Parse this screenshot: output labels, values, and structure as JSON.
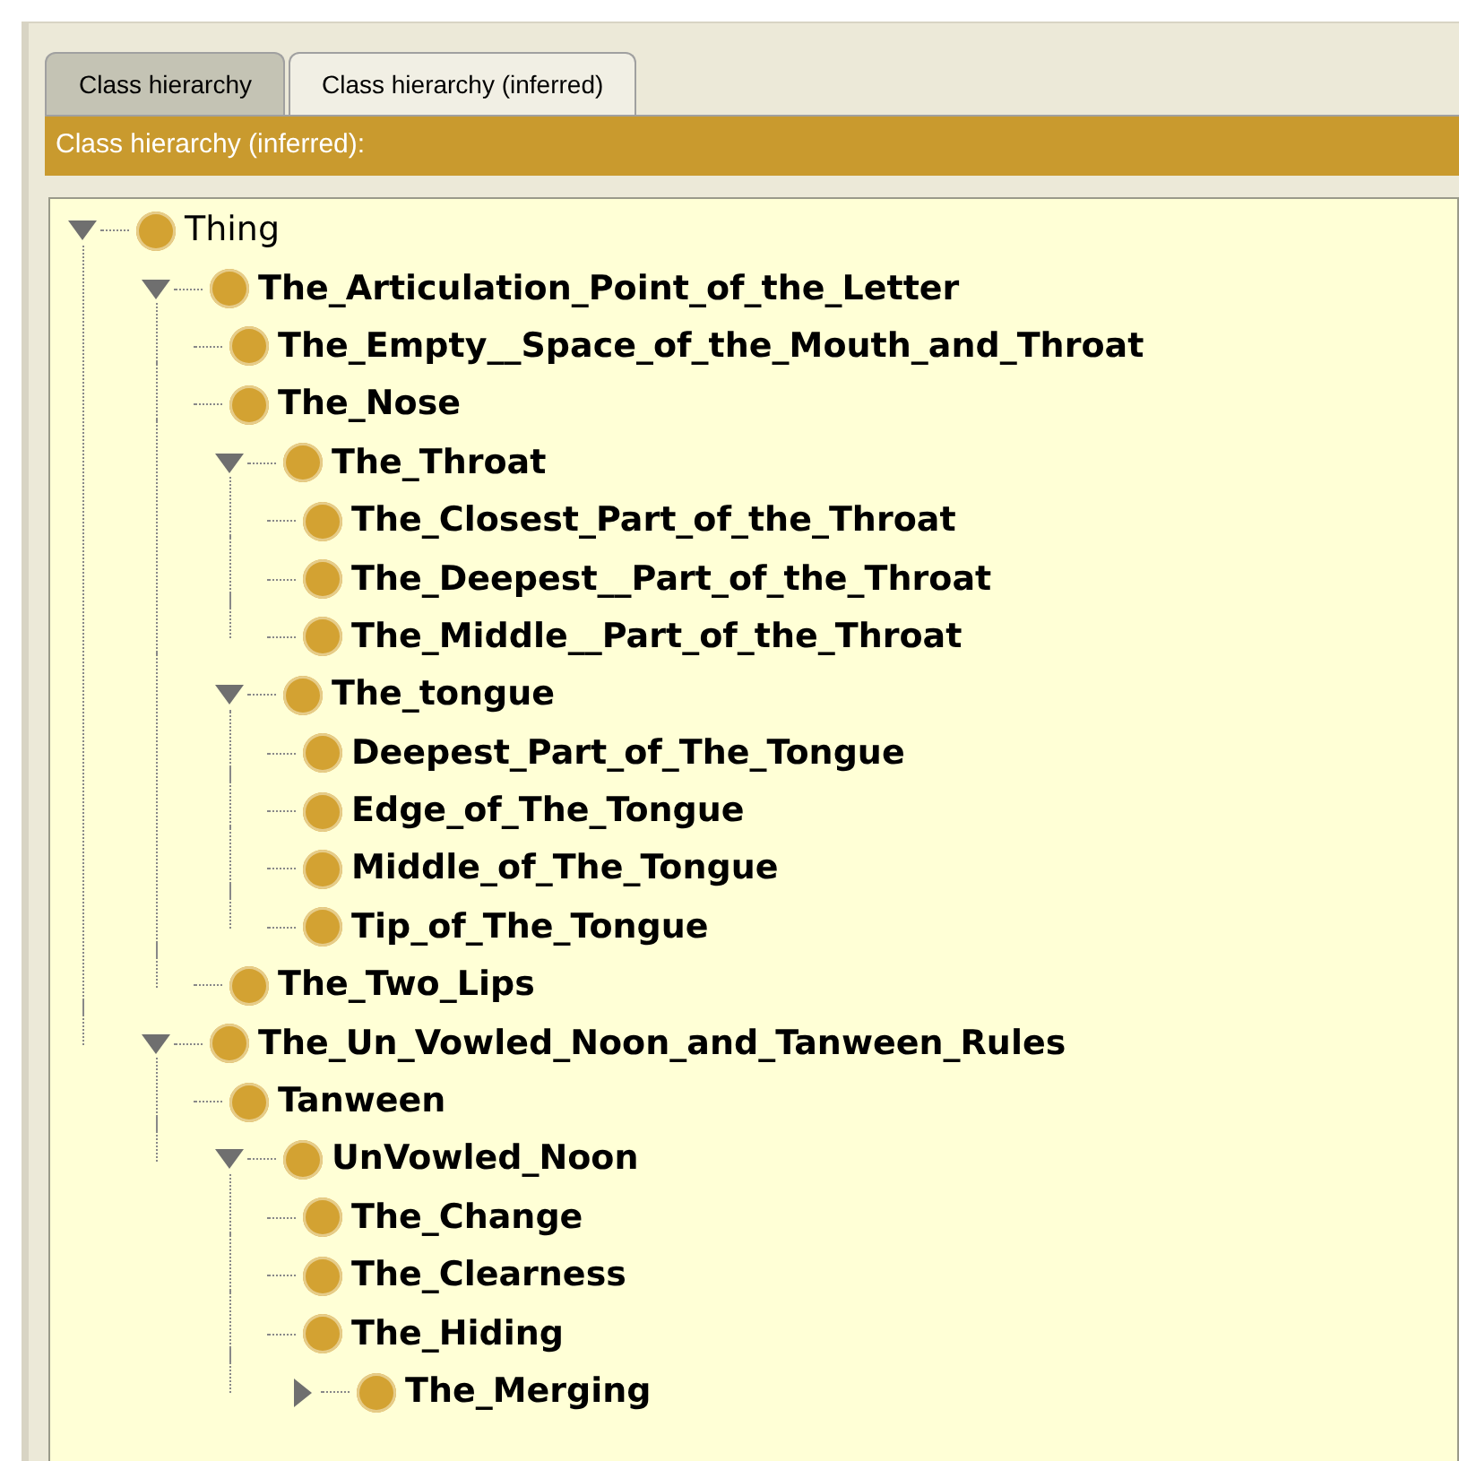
{
  "tabs": [
    {
      "label": "Class hierarchy",
      "selected": false
    },
    {
      "label": "Class hierarchy (inferred)",
      "selected": true
    }
  ],
  "panel": {
    "title": "Class hierarchy (inferred):"
  },
  "tree": [
    {
      "label": "Thing",
      "expanded": true,
      "children": [
        {
          "label": "The_Articulation_Point_of_the_Letter",
          "expanded": true,
          "children": [
            {
              "label": "The_Empty__Space_of_the_Mouth_and_Throat"
            },
            {
              "label": "The_Nose"
            },
            {
              "label": "The_Throat",
              "expanded": true,
              "children": [
                {
                  "label": "The_Closest_Part_of_the_Throat"
                },
                {
                  "label": "The_Deepest__Part_of_the_Throat"
                },
                {
                  "label": "The_Middle__Part_of_the_Throat"
                }
              ]
            },
            {
              "label": "The_tongue",
              "expanded": true,
              "children": [
                {
                  "label": "Deepest_Part_of_The_Tongue"
                },
                {
                  "label": "Edge_of_The_Tongue"
                },
                {
                  "label": "Middle_of_The_Tongue"
                },
                {
                  "label": "Tip_of_The_Tongue"
                }
              ]
            },
            {
              "label": "The_Two_Lips"
            }
          ]
        },
        {
          "label": "The_Un_Vowled_Noon_and_Tanween_Rules",
          "expanded": true,
          "children": [
            {
              "label": "Tanween"
            },
            {
              "label": "UnVowled_Noon",
              "expanded": true,
              "children": [
                {
                  "label": "The_Change"
                },
                {
                  "label": "The_Clearness"
                },
                {
                  "label": "The_Hiding"
                },
                {
                  "label": "The_Merging",
                  "expanded": false
                }
              ]
            }
          ]
        }
      ]
    }
  ]
}
